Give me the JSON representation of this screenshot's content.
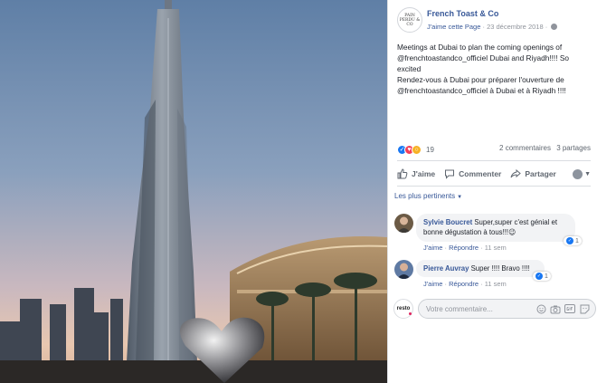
{
  "post": {
    "page_avatar_text": "PAIN PERDU & CO",
    "page_name": "French Toast & Co",
    "like_page": "J'aime cette Page",
    "separator": "·",
    "date": "23 décembre 2018",
    "text": "Meetings at Dubai to plan the coming openings of @frenchtoastandco_officiel Dubai and Riyadh!!!! So excited\nRendez-vous à Dubai pour préparer l'ouverture de @frenchtoastandco_officiel à Dubai et à Riyadh !!!!",
    "reaction_count": "19",
    "comments_count": "2 commentaires",
    "shares_count": "3 partages"
  },
  "actions": {
    "like": "J'aime",
    "comment": "Commenter",
    "share": "Partager"
  },
  "comments_filter": "Les plus pertinents",
  "comments": [
    {
      "author": "Sylvie Boucret",
      "text": "Super,super c'est génial et bonne dégustation à tous!!!",
      "emoji": "😉",
      "like_count": "1",
      "like_label": "J'aime",
      "reply_label": "Répondre",
      "time": "11 sem"
    },
    {
      "author": "Pierre Auvray",
      "text": "Super !!!! Bravo !!!!",
      "like_count": "1",
      "like_label": "J'aime",
      "reply_label": "Répondre",
      "time": "11 sem"
    }
  ],
  "composer": {
    "logo_text": "resto",
    "placeholder": "Votre commentaire..."
  },
  "colors": {
    "link_blue": "#385898",
    "like_blue": "#1877f2",
    "love_red": "#f33e58",
    "wow_yellow": "#f7b125",
    "muted_gray": "#90949c",
    "bubble_bg": "#f2f3f5"
  },
  "icons": {
    "like": "thumbs-up-icon",
    "comment": "speech-bubble-icon",
    "share": "share-arrow-icon",
    "privacy": "globe-icon",
    "emoji": "smiley-icon",
    "camera": "camera-icon",
    "gif": "gif-icon",
    "sticker": "sticker-icon"
  }
}
